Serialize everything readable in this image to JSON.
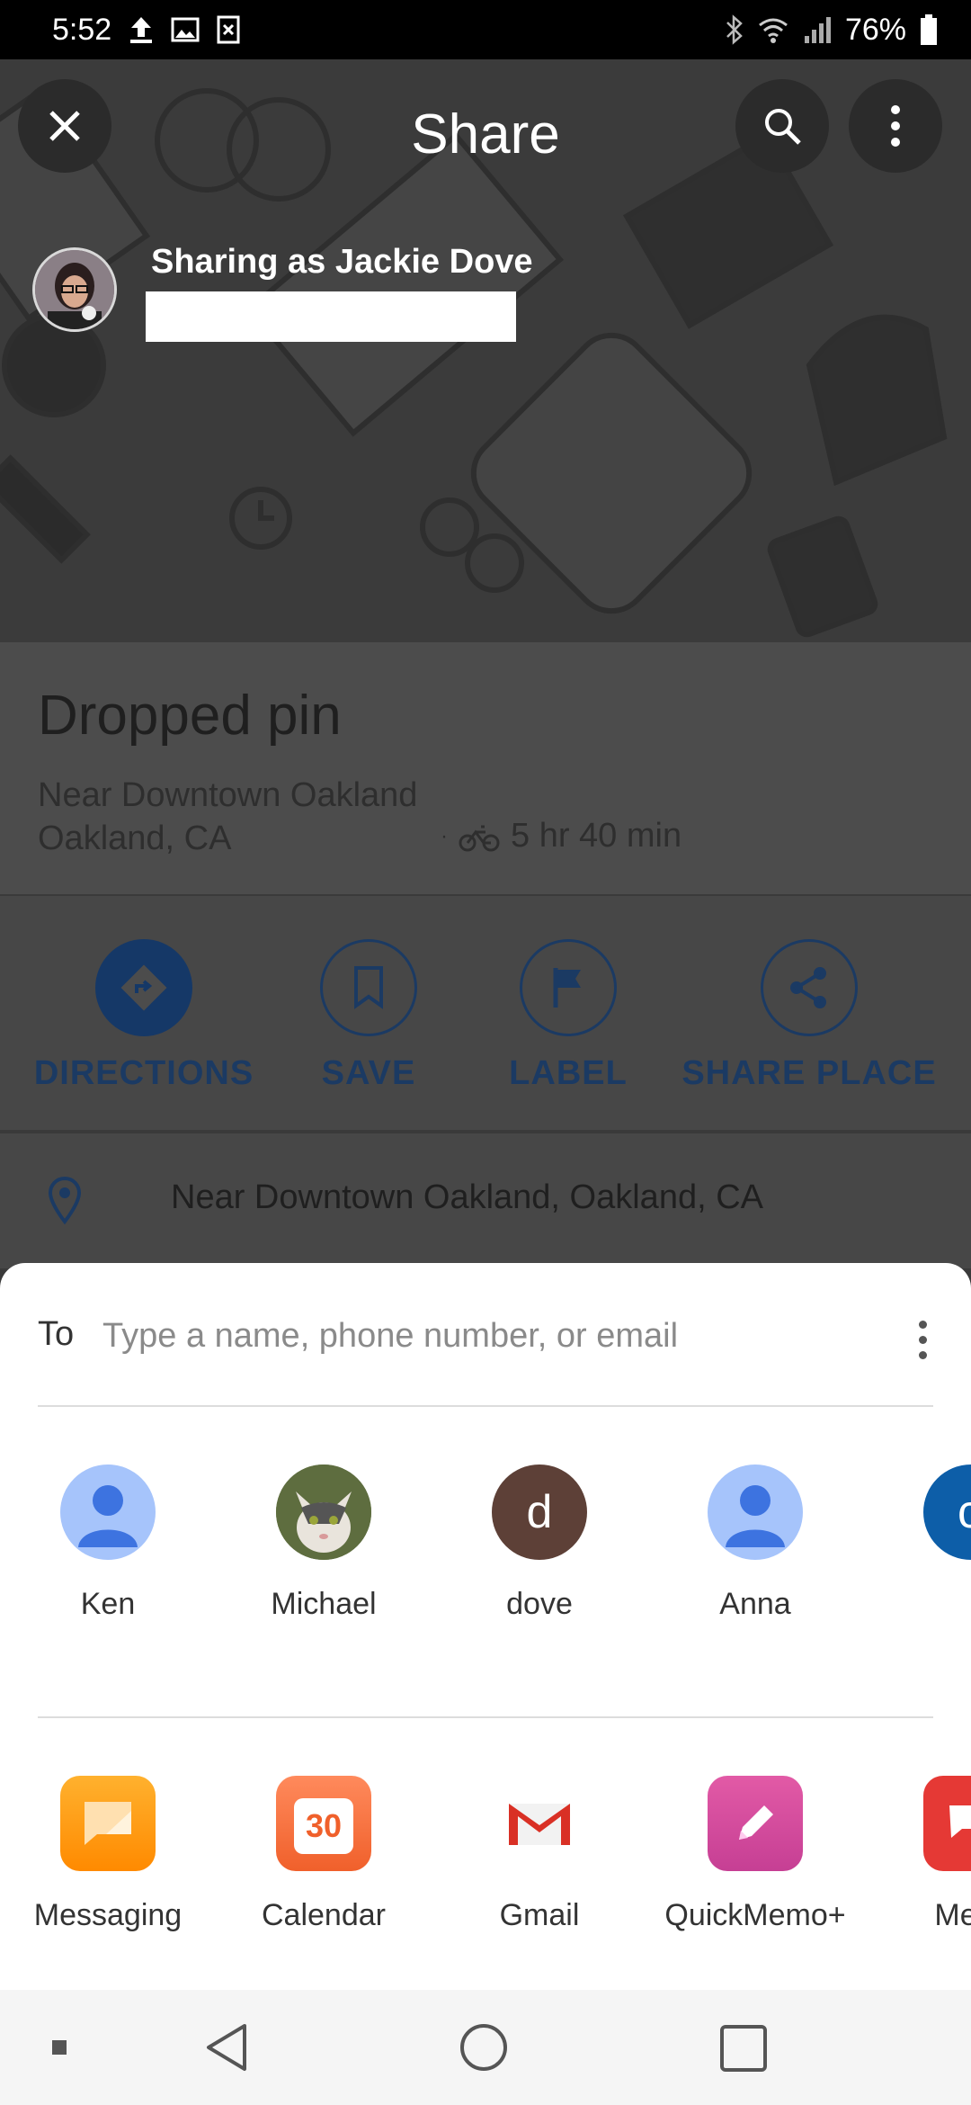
{
  "status_bar": {
    "time": "5:52",
    "battery": "76%"
  },
  "header": {
    "title": "Share",
    "sharing_as": "Sharing as Jackie Dove"
  },
  "place": {
    "title": "Dropped pin",
    "line1": "Near Downtown Oakland",
    "line2": "Oakland, CA",
    "travel_time": "5 hr 40 min",
    "address": "Near Downtown Oakland, Oakland, CA"
  },
  "actions": [
    {
      "label": "DIRECTIONS"
    },
    {
      "label": "SAVE"
    },
    {
      "label": "LABEL"
    },
    {
      "label": "SHARE PLACE"
    }
  ],
  "share_sheet": {
    "to_label": "To",
    "to_placeholder": "Type a name, phone number, or email",
    "contacts": [
      {
        "name": "Ken"
      },
      {
        "name": "Michael"
      },
      {
        "name": "dove",
        "initial": "d"
      },
      {
        "name": "Anna"
      },
      {
        "initial": "c"
      }
    ],
    "apps": [
      {
        "name": "Messaging",
        "icon": "messaging-icon"
      },
      {
        "name": "Calendar",
        "icon": "calendar-icon",
        "badge": "30"
      },
      {
        "name": "Gmail",
        "icon": "gmail-icon"
      },
      {
        "name": "QuickMemo+",
        "icon": "quickmemo-icon"
      },
      {
        "name": "Mess",
        "icon": "messages-icon"
      }
    ]
  },
  "colors": {
    "accent": "#1b3a63",
    "sheet_bg": "#ffffff",
    "scrim": "#3b3b3b"
  }
}
